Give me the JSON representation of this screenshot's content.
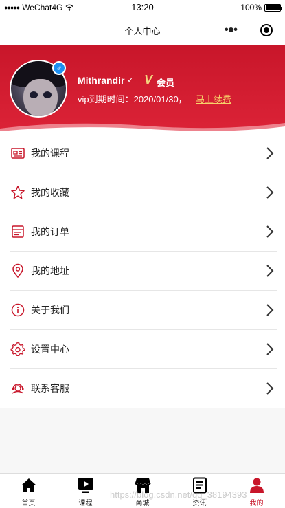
{
  "status_bar": {
    "carrier": "WeChat4G",
    "time": "13:20",
    "battery": "100%",
    "signal_icon": "signal-dots-icon",
    "wifi_icon": "wifi-icon"
  },
  "nav": {
    "title": "个人中心",
    "more_icon": "more-dots-icon",
    "close_icon": "target-circle-icon"
  },
  "profile": {
    "username": "Mithrandir",
    "gender": "♂",
    "vip_icon": "V",
    "vip_label": "会员",
    "expiry_text": "vip到期时间：2020/01/30，",
    "renew_link": "马上续费",
    "brand_color": "#c8162a",
    "renew_color": "#f7d46a"
  },
  "menu": {
    "items": [
      {
        "label": "我的课程",
        "icon": "course-card-icon"
      },
      {
        "label": "我的收藏",
        "icon": "star-icon"
      },
      {
        "label": "我的订单",
        "icon": "order-icon"
      },
      {
        "label": "我的地址",
        "icon": "location-pin-icon"
      },
      {
        "label": "关于我们",
        "icon": "info-icon"
      },
      {
        "label": "设置中心",
        "icon": "gear-icon"
      },
      {
        "label": "联系客服",
        "icon": "customer-service-icon"
      }
    ]
  },
  "tabs": [
    {
      "label": "首页",
      "icon": "home-icon"
    },
    {
      "label": "课程",
      "icon": "play-icon"
    },
    {
      "label": "商城",
      "icon": "shop-icon"
    },
    {
      "label": "资讯",
      "icon": "news-icon"
    },
    {
      "label": "我的",
      "icon": "user-icon",
      "active": true
    }
  ],
  "watermark": "https://blog.csdn.net/qq_38194393"
}
